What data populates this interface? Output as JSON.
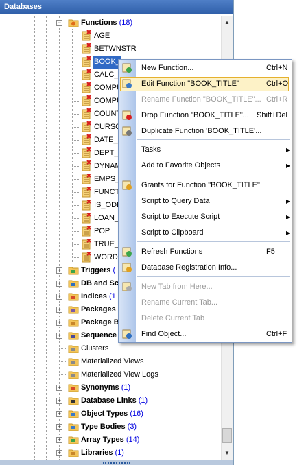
{
  "panel": {
    "title": "Databases"
  },
  "tree": {
    "functions": {
      "label": "Functions",
      "count": "(18)"
    },
    "function_items": [
      "AGE",
      "BETWNSTR",
      "BOOK_",
      "CALC_",
      "COMPU",
      "COMPU",
      "COUNT",
      "CURSO",
      "DATE_",
      "DEPT_F",
      "DYNAM",
      "EMPS_",
      "FUNCT",
      "IS_ODD",
      "LOAN_",
      "POP",
      "TRUE_",
      "WORDC"
    ],
    "groups": [
      {
        "label": "Triggers",
        "count": "("
      },
      {
        "label": "DB and Sc",
        "count": ""
      },
      {
        "label": "Indices",
        "count": "(1"
      },
      {
        "label": "Packages",
        "count": ""
      },
      {
        "label": "Package B",
        "count": ""
      },
      {
        "label": "Sequence",
        "count": ""
      }
    ],
    "plain_items": [
      "Clusters",
      "Materialized Views",
      "Materialized View Logs"
    ],
    "groups2": [
      {
        "label": "Synonyms",
        "count": "(1)"
      },
      {
        "label": "Database Links",
        "count": "(1)"
      },
      {
        "label": "Object Types",
        "count": "(16)"
      },
      {
        "label": "Type Bodies",
        "count": "(3)"
      },
      {
        "label": "Array Types",
        "count": "(14)"
      },
      {
        "label": "Libraries",
        "count": "(1)"
      }
    ]
  },
  "menu": {
    "items": [
      {
        "label": "New Function...",
        "shortcut": "Ctrl+N",
        "enabled": true,
        "icon": "new-function-icon"
      },
      {
        "label": "Edit Function \"BOOK_TITLE\"",
        "shortcut": "Ctrl+O",
        "enabled": true,
        "icon": "edit-function-icon",
        "hover": true
      },
      {
        "label": "Rename Function \"BOOK_TITLE\"...",
        "shortcut": "Ctrl+R",
        "enabled": false
      },
      {
        "label": "Drop Function \"BOOK_TITLE\"...",
        "shortcut": "Shift+Del",
        "enabled": true,
        "icon": "drop-function-icon"
      },
      {
        "label": "Duplicate Function 'BOOK_TITLE'...",
        "shortcut": "",
        "enabled": true,
        "icon": "duplicate-function-icon"
      },
      {
        "label": "Tasks",
        "submenu": true,
        "enabled": true
      },
      {
        "label": "Add to Favorite Objects",
        "submenu": true,
        "enabled": true
      },
      {
        "label": "Grants for Function \"BOOK_TITLE\"",
        "shortcut": "",
        "enabled": true,
        "icon": "grants-icon"
      },
      {
        "label": "Script to Query Data",
        "submenu": true,
        "enabled": true
      },
      {
        "label": "Script to Execute Script",
        "submenu": true,
        "enabled": true
      },
      {
        "label": "Script to Clipboard",
        "submenu": true,
        "enabled": true
      },
      {
        "label": "Refresh Functions",
        "shortcut": "F5",
        "enabled": true,
        "icon": "refresh-icon"
      },
      {
        "label": "Database Registration Info...",
        "shortcut": "",
        "enabled": true,
        "icon": "registration-info-icon"
      },
      {
        "label": "New Tab from Here...",
        "shortcut": "",
        "enabled": false,
        "icon": "new-tab-icon"
      },
      {
        "label": "Rename Current Tab...",
        "shortcut": "",
        "enabled": false
      },
      {
        "label": "Delete Current Tab",
        "shortcut": "",
        "enabled": false
      },
      {
        "label": "Find Object...",
        "shortcut": "Ctrl+F",
        "enabled": true,
        "icon": "find-icon"
      }
    ]
  },
  "colors": {
    "accent": "#316ac5",
    "count_blue": "#0000e0",
    "menu_hover": "#fdf2c7"
  }
}
